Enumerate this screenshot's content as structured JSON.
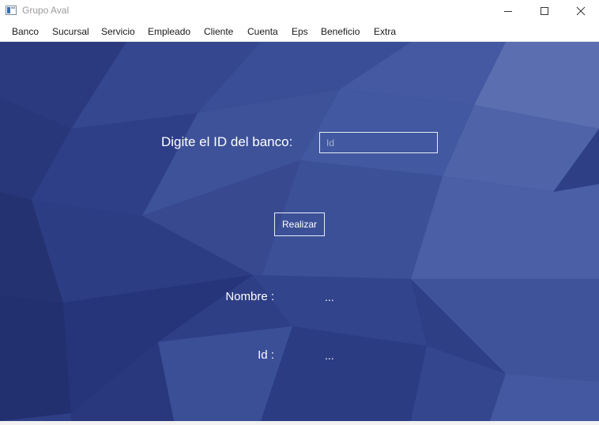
{
  "window": {
    "title": "Grupo Aval"
  },
  "menu": {
    "items": [
      "Banco",
      "Sucursal",
      "Servicio",
      "Empleado",
      "Cliente",
      "Cuenta",
      "Eps",
      "Beneficio",
      "Extra"
    ]
  },
  "form": {
    "prompt_label": "Digite el ID del banco:",
    "id_input": {
      "value": "",
      "placeholder": "Id"
    },
    "submit_label": "Realizar"
  },
  "results": {
    "nombre_label": "Nombre :",
    "nombre_value": "...",
    "id_label": "Id :",
    "id_value": "..."
  },
  "colors": {
    "background": "#2f3f86",
    "text": "#ffffff"
  },
  "icons": [
    "app-icon",
    "minimize-icon",
    "maximize-icon",
    "close-icon"
  ]
}
